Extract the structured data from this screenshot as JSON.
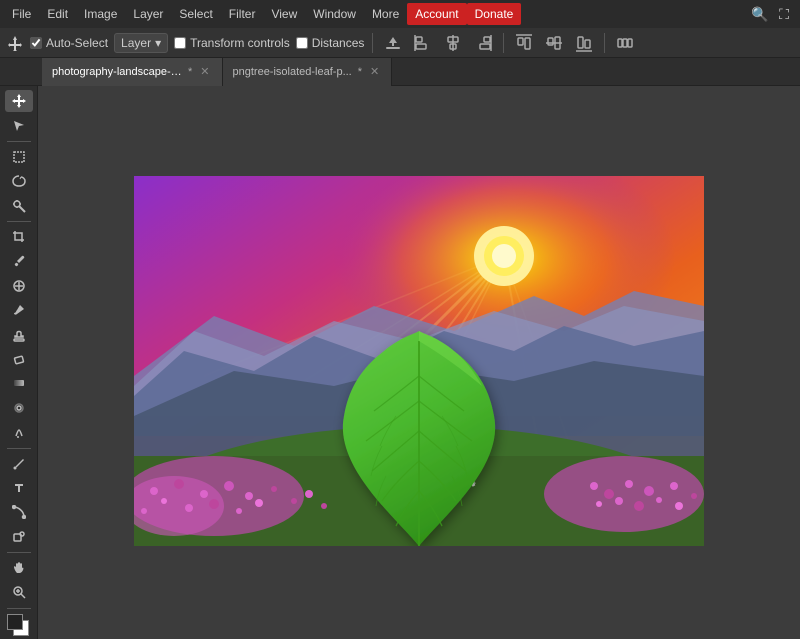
{
  "menubar": {
    "items": [
      {
        "label": "File",
        "id": "file"
      },
      {
        "label": "Edit",
        "id": "edit"
      },
      {
        "label": "Image",
        "id": "image"
      },
      {
        "label": "Layer",
        "id": "layer"
      },
      {
        "label": "Select",
        "id": "select"
      },
      {
        "label": "Filter",
        "id": "filter"
      },
      {
        "label": "View",
        "id": "view"
      },
      {
        "label": "Window",
        "id": "window"
      },
      {
        "label": "More",
        "id": "more"
      },
      {
        "label": "Account",
        "id": "account",
        "active": true
      },
      {
        "label": "Donate",
        "id": "donate",
        "donate": true
      }
    ]
  },
  "optionsbar": {
    "auto_select_label": "Auto-Select",
    "layer_label": "Layer",
    "transform_controls_label": "Transform controls",
    "distances_label": "Distances",
    "auto_select_checked": true,
    "transform_checked": false,
    "distances_checked": false
  },
  "tabs": [
    {
      "name": "photography-landscape-a...",
      "active": true,
      "modified": true
    },
    {
      "name": "pngtree-isolated-leaf-p...",
      "active": false,
      "modified": true
    }
  ],
  "tools": [
    {
      "icon": "↖",
      "name": "move-tool",
      "active": true
    },
    {
      "icon": "⬚",
      "name": "marquee-tool"
    },
    {
      "icon": "⚲",
      "name": "lasso-tool"
    },
    {
      "icon": "✳",
      "name": "magic-wand-tool"
    },
    {
      "icon": "✂",
      "name": "crop-tool"
    },
    {
      "icon": "⊕",
      "name": "eyedropper-tool"
    },
    {
      "icon": "⚕",
      "name": "healing-tool"
    },
    {
      "icon": "✏",
      "name": "brush-tool"
    },
    {
      "icon": "⊕",
      "name": "stamp-tool"
    },
    {
      "icon": "◈",
      "name": "eraser-tool"
    },
    {
      "icon": "▣",
      "name": "gradient-tool"
    },
    {
      "icon": "◉",
      "name": "blur-tool"
    },
    {
      "icon": "○",
      "name": "dodge-tool"
    },
    {
      "icon": "P",
      "name": "pen-tool"
    },
    {
      "icon": "T",
      "name": "type-tool"
    },
    {
      "icon": "⟋",
      "name": "path-tool"
    },
    {
      "icon": "⊗",
      "name": "shape-tool"
    },
    {
      "icon": "↔",
      "name": "hand-tool"
    },
    {
      "icon": "🔍",
      "name": "zoom-tool"
    }
  ],
  "colors": {
    "accent_red": "#cc2222",
    "menu_bg": "#2b2b2b",
    "toolbar_bg": "#333333",
    "canvas_bg": "#3c3c3c",
    "panel_bg": "#2e2e2e",
    "tab_active_bg": "#444444"
  }
}
